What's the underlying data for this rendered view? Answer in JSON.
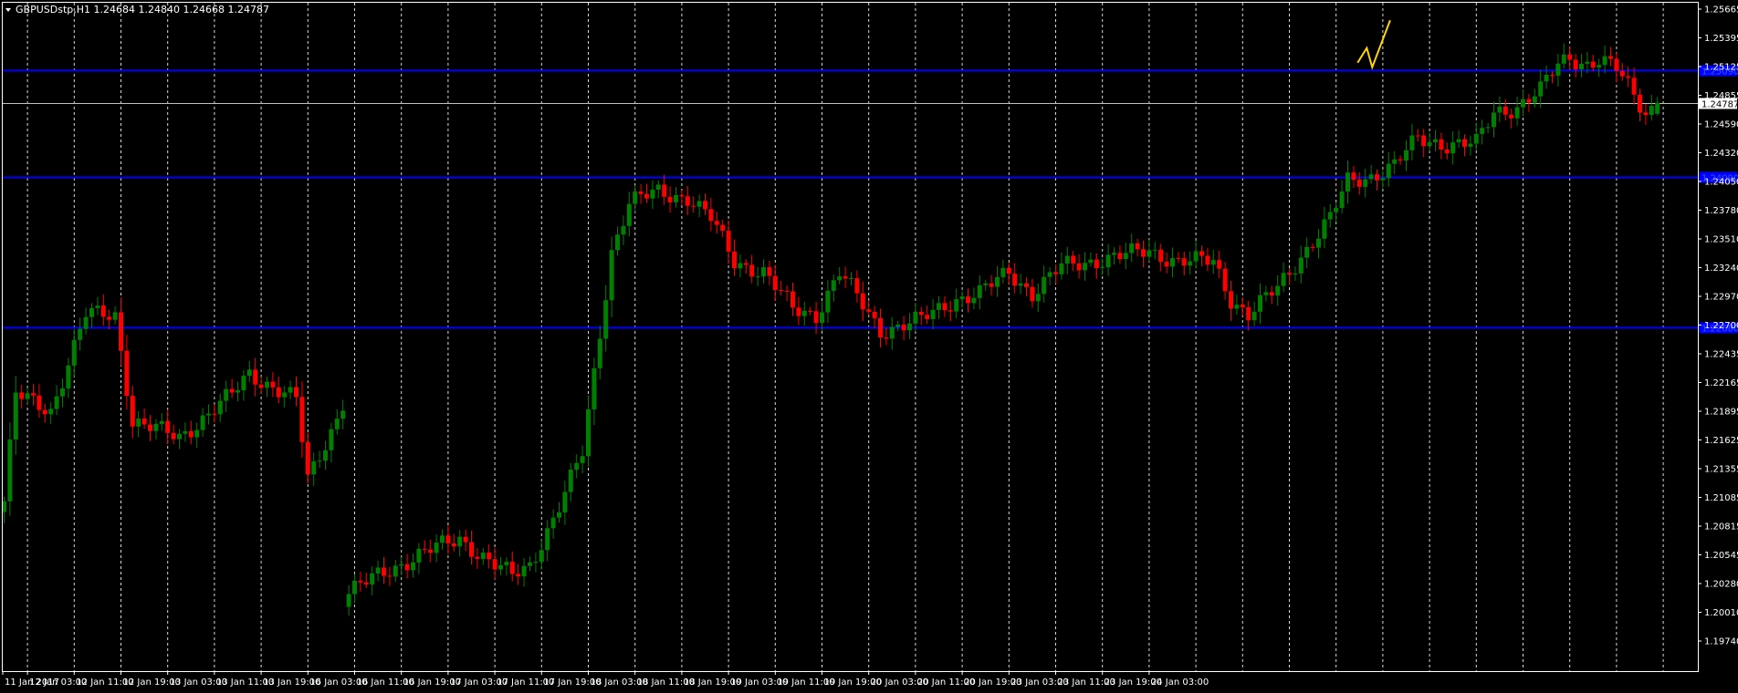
{
  "symbol_title": "GBPUSDstp,H1  1.24684 1.24840 1.24668 1.24787",
  "colors": {
    "background": "#000000",
    "frame": "#ffffff",
    "grid": "#ffffff",
    "bull": "#008000",
    "bear": "#ff0000",
    "hline": "#0000ff",
    "price_line": "#c0c0c0",
    "trend": "#ffd400"
  },
  "chart_data": {
    "type": "candlestick",
    "title": "GBPUSDstp,H1",
    "ohlc_header": {
      "open": 1.24684,
      "high": 1.2484,
      "low": 1.24668,
      "close": 1.24787
    },
    "current_price": 1.24787,
    "ylim": [
      1.1974,
      1.25665
    ],
    "y_ticks": [
      "1.25665",
      "1.25395",
      "1.25125",
      "1.24855",
      "1.24590",
      "1.24320",
      "1.24050",
      "1.23780",
      "1.23510",
      "1.23240",
      "1.22970",
      "1.22700",
      "1.22435",
      "1.22165",
      "1.21895",
      "1.21625",
      "1.21355",
      "1.21085",
      "1.20815",
      "1.20545",
      "1.20280",
      "1.20010",
      "1.19740"
    ],
    "x_labels": [
      "11 Jan 2017",
      "12 Jan 03:00",
      "12 Jan 11:00",
      "12 Jan 19:00",
      "13 Jan 03:00",
      "13 Jan 11:00",
      "13 Jan 19:00",
      "16 Jan 03:00",
      "16 Jan 11:00",
      "16 Jan 19:00",
      "17 Jan 03:00",
      "17 Jan 11:00",
      "17 Jan 19:00",
      "18 Jan 03:00",
      "18 Jan 11:00",
      "18 Jan 19:00",
      "19 Jan 03:00",
      "19 Jan 11:00",
      "19 Jan 19:00",
      "20 Jan 03:00",
      "20 Jan 11:00",
      "20 Jan 19:00",
      "23 Jan 03:00",
      "23 Jan 11:00",
      "23 Jan 19:00",
      "24 Jan 03:00"
    ],
    "horizontal_lines": [
      {
        "price": 1.2509,
        "price_label": "1.25090"
      },
      {
        "price": 1.2409,
        "price_label": "1.24090"
      },
      {
        "price": 1.2268,
        "price_label": "1.22680"
      }
    ],
    "grid": "dashed vertical",
    "trend_arrow": {
      "from": [
        232,
        1.2518
      ],
      "to": [
        236,
        1.2556
      ]
    },
    "key_points": [
      [
        0,
        1.2105
      ],
      [
        2,
        1.2205
      ],
      [
        8,
        1.219
      ],
      [
        14,
        1.228
      ],
      [
        19,
        1.228
      ],
      [
        22,
        1.218
      ],
      [
        30,
        1.2165
      ],
      [
        39,
        1.2205
      ],
      [
        42,
        1.2225
      ],
      [
        50,
        1.22
      ],
      [
        52,
        1.2125
      ],
      [
        58,
        1.2195
      ],
      [
        59,
        1.202
      ],
      [
        64,
        1.2035
      ],
      [
        71,
        1.2055
      ],
      [
        78,
        1.207
      ],
      [
        84,
        1.2045
      ],
      [
        87,
        1.2035
      ],
      [
        90,
        1.2045
      ],
      [
        95,
        1.21
      ],
      [
        99,
        1.215
      ],
      [
        101,
        1.2225
      ],
      [
        104,
        1.234
      ],
      [
        107,
        1.2385
      ],
      [
        112,
        1.2395
      ],
      [
        117,
        1.239
      ],
      [
        121,
        1.237
      ],
      [
        125,
        1.233
      ],
      [
        130,
        1.232
      ],
      [
        135,
        1.2285
      ],
      [
        139,
        1.228
      ],
      [
        143,
        1.232
      ],
      [
        150,
        1.2265
      ],
      [
        157,
        1.2275
      ],
      [
        163,
        1.2295
      ],
      [
        167,
        1.23
      ],
      [
        172,
        1.232
      ],
      [
        176,
        1.23
      ],
      [
        181,
        1.2325
      ],
      [
        186,
        1.233
      ],
      [
        191,
        1.2335
      ],
      [
        196,
        1.234
      ],
      [
        201,
        1.233
      ],
      [
        207,
        1.233
      ],
      [
        210,
        1.2295
      ],
      [
        213,
        1.228
      ],
      [
        218,
        1.2305
      ],
      [
        222,
        1.2335
      ],
      [
        227,
        1.237
      ],
      [
        230,
        1.2405
      ],
      [
        234,
        1.241
      ],
      [
        238,
        1.242
      ],
      [
        242,
        1.2445
      ],
      [
        247,
        1.244
      ],
      [
        252,
        1.244
      ],
      [
        255,
        1.247
      ],
      [
        259,
        1.2475
      ],
      [
        263,
        1.249
      ],
      [
        266,
        1.2515
      ],
      [
        268,
        1.2522
      ],
      [
        271,
        1.2515
      ],
      [
        273,
        1.2518
      ],
      [
        276,
        1.251
      ],
      [
        278,
        1.2495
      ],
      [
        281,
        1.247
      ],
      [
        283,
        1.2478
      ]
    ],
    "bar_count": 284,
    "first_bar_label_index": 4,
    "bars_per_label": 8
  }
}
